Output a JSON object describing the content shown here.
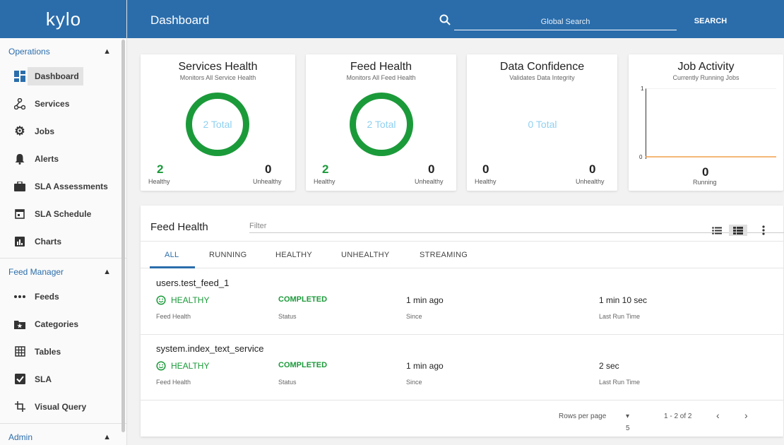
{
  "app": {
    "logo": "KYLO",
    "page_title": "Dashboard"
  },
  "search": {
    "placeholder": "Global Search",
    "button": "SEARCH"
  },
  "sidebar": {
    "operations_label": "Operations",
    "operations_items": [
      {
        "label": "Dashboard",
        "icon": "dashboard-icon",
        "active": true
      },
      {
        "label": "Services",
        "icon": "services-icon"
      },
      {
        "label": "Jobs",
        "icon": "gear-icon"
      },
      {
        "label": "Alerts",
        "icon": "bell-icon"
      },
      {
        "label": "SLA Assessments",
        "icon": "briefcase-icon"
      },
      {
        "label": "SLA Schedule",
        "icon": "calendar-icon"
      },
      {
        "label": "Charts",
        "icon": "chart-icon"
      }
    ],
    "feed_manager_label": "Feed Manager",
    "feed_manager_items": [
      {
        "label": "Feeds",
        "icon": "dots-icon"
      },
      {
        "label": "Categories",
        "icon": "folder-star-icon"
      },
      {
        "label": "Tables",
        "icon": "grid-icon"
      },
      {
        "label": "SLA",
        "icon": "check-box-icon"
      },
      {
        "label": "Visual Query",
        "icon": "crop-icon"
      }
    ],
    "admin_label": "Admin"
  },
  "cards": {
    "services": {
      "title": "Services Health",
      "subtitle": "Monitors All Service Health",
      "total": "2 Total",
      "healthy": "2",
      "healthy_label": "Healthy",
      "unhealthy": "0",
      "unhealthy_label": "Unhealthy"
    },
    "feed": {
      "title": "Feed Health",
      "subtitle": "Monitors All Feed Health",
      "total": "2 Total",
      "healthy": "2",
      "healthy_label": "Healthy",
      "unhealthy": "0",
      "unhealthy_label": "Unhealthy"
    },
    "confidence": {
      "title": "Data Confidence",
      "subtitle": "Validates Data Integrity",
      "total": "0 Total",
      "healthy": "0",
      "healthy_label": "Healthy",
      "unhealthy": "0",
      "unhealthy_label": "Unhealthy"
    },
    "jobs": {
      "title": "Job Activity",
      "subtitle": "Currently Running Jobs",
      "y_max": "1",
      "y_min": "0",
      "running": "0",
      "running_label": "Running"
    }
  },
  "feed_panel": {
    "title": "Feed Health",
    "filter_placeholder": "Filter",
    "tabs": [
      "ALL",
      "RUNNING",
      "HEALTHY",
      "UNHEALTHY",
      "STREAMING"
    ],
    "rows": [
      {
        "name": "users.test_feed_1",
        "health": "HEALTHY",
        "health_label": "Feed Health",
        "status": "COMPLETED",
        "status_label": "Status",
        "since": "1 min ago",
        "since_label": "Since",
        "last_run": "1 min 10 sec",
        "last_run_label": "Last Run Time"
      },
      {
        "name": "system.index_text_service",
        "health": "HEALTHY",
        "health_label": "Feed Health",
        "status": "COMPLETED",
        "status_label": "Status",
        "since": "1 min ago",
        "since_label": "Since",
        "last_run": "2 sec",
        "last_run_label": "Last Run Time"
      }
    ],
    "footer": {
      "rows_per_page_label": "Rows per page",
      "rows_per_page": "5",
      "range": "1 - 2 of 2"
    }
  },
  "colors": {
    "primary": "#2b6dab",
    "healthy": "#1b9a3a",
    "total_label": "#8fd0f0",
    "job_line": "#f0a04b"
  }
}
